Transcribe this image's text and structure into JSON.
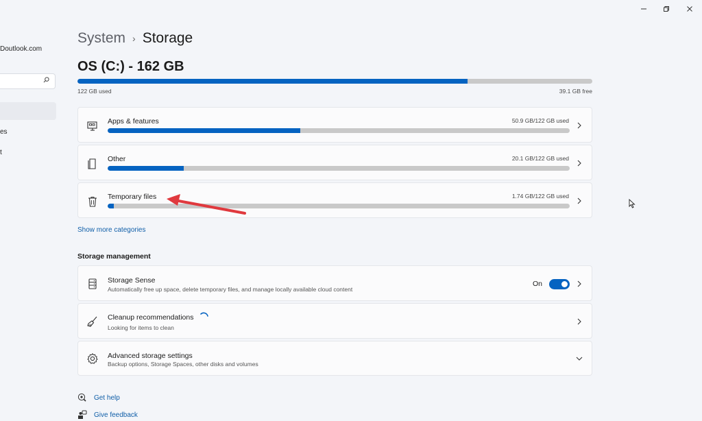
{
  "window": {
    "minimize_icon": "minimize-icon",
    "restore_icon": "restore-icon",
    "close_icon": "close-icon"
  },
  "sidebar": {
    "email_fragment": "Doutlook.com",
    "search_icon": "search-icon",
    "item_fragment_1": "es",
    "item_fragment_2": "t"
  },
  "breadcrumb": {
    "parent": "System",
    "separator": "›",
    "current": "Storage"
  },
  "drive": {
    "title": "OS (C:) - 162 GB",
    "used_label": "122 GB used",
    "free_label": "39.1 GB free",
    "used_fraction": 0.757
  },
  "categories": [
    {
      "label": "Apps & features",
      "size": "50.9 GB/122 GB used",
      "fraction": 0.417,
      "icon": "apps-icon"
    },
    {
      "label": "Other",
      "size": "20.1 GB/122 GB used",
      "fraction": 0.165,
      "icon": "document-icon"
    },
    {
      "label": "Temporary files",
      "size": "1.74 GB/122 GB used",
      "fraction": 0.014,
      "icon": "trash-icon"
    }
  ],
  "show_more": "Show more categories",
  "management": {
    "heading": "Storage management",
    "items": [
      {
        "label": "Storage Sense",
        "sub": "Automatically free up space, delete temporary files, and manage locally available cloud content",
        "icon": "storage-icon",
        "toggle_label": "On",
        "toggle_on": true
      },
      {
        "label": "Cleanup recommendations",
        "sub": "Looking for items to clean",
        "icon": "broom-icon",
        "loading": true
      },
      {
        "label": "Advanced storage settings",
        "sub": "Backup options, Storage Spaces, other disks and volumes",
        "icon": "gear-icon"
      }
    ]
  },
  "footer": {
    "help": "Get help",
    "feedback": "Give feedback"
  },
  "colors": {
    "accent": "#0563c1",
    "annotation_arrow": "#e0393e"
  }
}
